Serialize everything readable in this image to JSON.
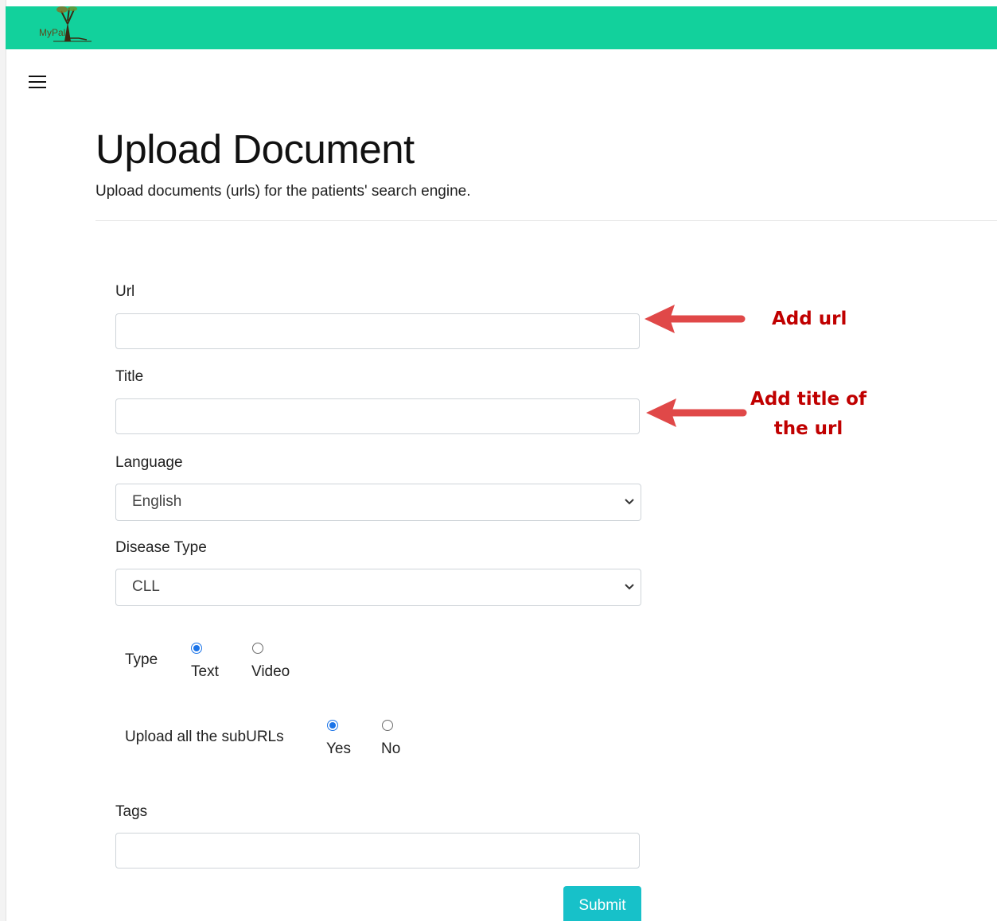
{
  "header": {
    "logo_text": "MyPal",
    "brand_color": "#12d19c"
  },
  "menu": {
    "icon": "hamburger-menu-icon"
  },
  "page": {
    "title": "Upload Document",
    "subtitle": "Upload documents (urls) for the patients' search engine."
  },
  "form": {
    "url": {
      "label": "Url",
      "value": "",
      "placeholder": ""
    },
    "title": {
      "label": "Title",
      "value": "",
      "placeholder": ""
    },
    "language": {
      "label": "Language",
      "selected": "English"
    },
    "disease_type": {
      "label": "Disease Type",
      "selected": "CLL"
    },
    "type": {
      "label": "Type",
      "options": [
        {
          "label": "Text",
          "checked": true
        },
        {
          "label": "Video",
          "checked": false
        }
      ]
    },
    "suburls": {
      "label": "Upload all the subURLs",
      "options": [
        {
          "label": "Yes",
          "checked": true
        },
        {
          "label": "No",
          "checked": false
        }
      ]
    },
    "tags": {
      "label": "Tags",
      "value": "",
      "placeholder": ""
    },
    "submit_label": "Submit",
    "submit_color": "#17c1c9"
  },
  "annotations": {
    "url_note": "Add url",
    "title_note_line1": "Add title of",
    "title_note_line2": "the url",
    "color": "#c00000",
    "arrow_color": "#e04848"
  }
}
